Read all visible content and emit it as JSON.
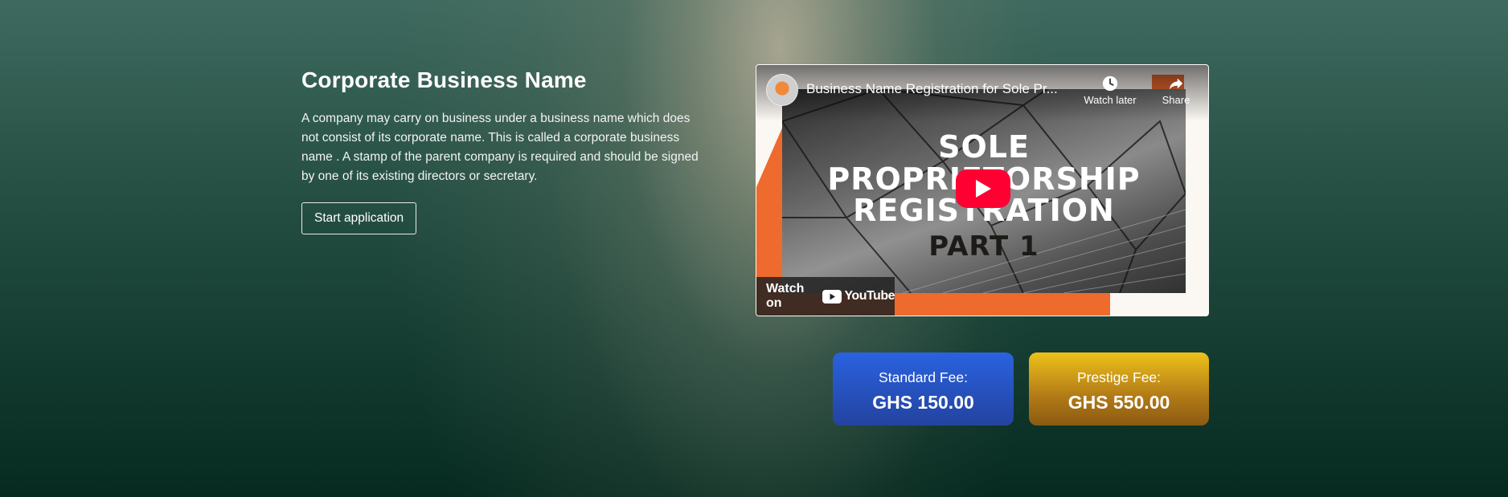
{
  "section": {
    "title": "Corporate Business Name",
    "description": "A company may carry on business under a business name which does not consist of its corporate name. This is called a corporate business name . A stamp of the parent company is required and should be signed by one of its existing directors or secretary.",
    "start_button": "Start application"
  },
  "video": {
    "title": "Business Name Registration for Sole Pr...",
    "watch_later_label": "Watch later",
    "share_label": "Share",
    "watch_on_label": "Watch on",
    "youtube_label": "YouTube",
    "thumbnail_text": {
      "line1": "SOLE",
      "line2": "PROPRIETORSHIP",
      "line3": "REGISTRATION",
      "line4": "PART 1"
    },
    "icons": [
      "channel-avatar",
      "clock-icon",
      "share-icon",
      "play-icon",
      "youtube-logo-icon"
    ]
  },
  "fees": [
    {
      "label": "Standard Fee:",
      "amount": "GHS 150.00",
      "color": "#2a5fd9"
    },
    {
      "label": "Prestige Fee:",
      "amount": "GHS 550.00",
      "color": "#d9a31a"
    }
  ]
}
